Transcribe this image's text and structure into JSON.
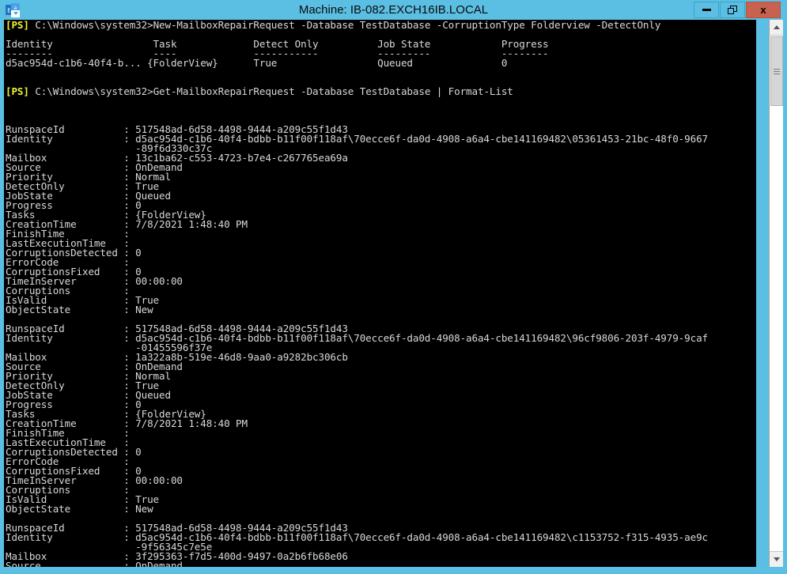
{
  "window": {
    "title": "Machine: IB-082.EXCH16IB.LOCAL",
    "icon": "exchange-icon",
    "minimize_label": "–",
    "restore_label": "❐",
    "close_label": "x",
    "colors": {
      "titlebar": "#5bbfe3",
      "close_button": "#c8614f",
      "console_background": "#000000",
      "console_text": "#d8d8d8",
      "prompt_text": "#f3f32e"
    }
  },
  "scrollbar": {
    "up_arrow": "scroll-up-arrow",
    "down_arrow": "scroll-down-arrow",
    "thumb": "scroll-thumb"
  },
  "console": {
    "prompt_prefix": "[PS]",
    "lines": [
      {
        "type": "command",
        "prompt": "[PS]",
        "text": " C:\\Windows\\system32>New-MailboxRepairRequest -Database TestDatabase -CorruptionType Folderview -DetectOnly"
      },
      {
        "type": "blank",
        "text": ""
      },
      {
        "type": "output",
        "text": "Identity                 Task             Detect Only          Job State            Progress"
      },
      {
        "type": "output",
        "text": "--------                 ----             -----------          ---------            --------"
      },
      {
        "type": "output",
        "text": "d5ac954d-c1b6-40f4-b... {FolderView}      True                 Queued               0"
      },
      {
        "type": "blank",
        "text": ""
      },
      {
        "type": "blank",
        "text": ""
      },
      {
        "type": "command",
        "prompt": "[PS]",
        "text": " C:\\Windows\\system32>Get-MailboxRepairRequest -Database TestDatabase | Format-List"
      },
      {
        "type": "blank",
        "text": ""
      },
      {
        "type": "blank",
        "text": ""
      },
      {
        "type": "blank",
        "text": ""
      },
      {
        "type": "output",
        "text": "RunspaceId          : 517548ad-6d58-4498-9444-a209c55f1d43"
      },
      {
        "type": "output",
        "text": "Identity            : d5ac954d-c1b6-40f4-bdbb-b11f00f118af\\70ecce6f-da0d-4908-a6a4-cbe141169482\\05361453-21bc-48f0-9667"
      },
      {
        "type": "output",
        "text": "                      -89f6d330c37c"
      },
      {
        "type": "output",
        "text": "Mailbox             : 13c1ba62-c553-4723-b7e4-c267765ea69a"
      },
      {
        "type": "output",
        "text": "Source              : OnDemand"
      },
      {
        "type": "output",
        "text": "Priority            : Normal"
      },
      {
        "type": "output",
        "text": "DetectOnly          : True"
      },
      {
        "type": "output",
        "text": "JobState            : Queued"
      },
      {
        "type": "output",
        "text": "Progress            : 0"
      },
      {
        "type": "output",
        "text": "Tasks               : {FolderView}"
      },
      {
        "type": "output",
        "text": "CreationTime        : 7/8/2021 1:48:40 PM"
      },
      {
        "type": "output",
        "text": "FinishTime          :"
      },
      {
        "type": "output",
        "text": "LastExecutionTime   :"
      },
      {
        "type": "output",
        "text": "CorruptionsDetected : 0"
      },
      {
        "type": "output",
        "text": "ErrorCode           :"
      },
      {
        "type": "output",
        "text": "CorruptionsFixed    : 0"
      },
      {
        "type": "output",
        "text": "TimeInServer        : 00:00:00"
      },
      {
        "type": "output",
        "text": "Corruptions         :"
      },
      {
        "type": "output",
        "text": "IsValid             : True"
      },
      {
        "type": "output",
        "text": "ObjectState         : New"
      },
      {
        "type": "blank",
        "text": ""
      },
      {
        "type": "output",
        "text": "RunspaceId          : 517548ad-6d58-4498-9444-a209c55f1d43"
      },
      {
        "type": "output",
        "text": "Identity            : d5ac954d-c1b6-40f4-bdbb-b11f00f118af\\70ecce6f-da0d-4908-a6a4-cbe141169482\\96cf9806-203f-4979-9caf"
      },
      {
        "type": "output",
        "text": "                      -01455596f37e"
      },
      {
        "type": "output",
        "text": "Mailbox             : 1a322a8b-519e-46d8-9aa0-a9282bc306cb"
      },
      {
        "type": "output",
        "text": "Source              : OnDemand"
      },
      {
        "type": "output",
        "text": "Priority            : Normal"
      },
      {
        "type": "output",
        "text": "DetectOnly          : True"
      },
      {
        "type": "output",
        "text": "JobState            : Queued"
      },
      {
        "type": "output",
        "text": "Progress            : 0"
      },
      {
        "type": "output",
        "text": "Tasks               : {FolderView}"
      },
      {
        "type": "output",
        "text": "CreationTime        : 7/8/2021 1:48:40 PM"
      },
      {
        "type": "output",
        "text": "FinishTime          :"
      },
      {
        "type": "output",
        "text": "LastExecutionTime   :"
      },
      {
        "type": "output",
        "text": "CorruptionsDetected : 0"
      },
      {
        "type": "output",
        "text": "ErrorCode           :"
      },
      {
        "type": "output",
        "text": "CorruptionsFixed    : 0"
      },
      {
        "type": "output",
        "text": "TimeInServer        : 00:00:00"
      },
      {
        "type": "output",
        "text": "Corruptions         :"
      },
      {
        "type": "output",
        "text": "IsValid             : True"
      },
      {
        "type": "output",
        "text": "ObjectState         : New"
      },
      {
        "type": "blank",
        "text": ""
      },
      {
        "type": "output",
        "text": "RunspaceId          : 517548ad-6d58-4498-9444-a209c55f1d43"
      },
      {
        "type": "output",
        "text": "Identity            : d5ac954d-c1b6-40f4-bdbb-b11f00f118af\\70ecce6f-da0d-4908-a6a4-cbe141169482\\c1153752-f315-4935-ae9c"
      },
      {
        "type": "output",
        "text": "                      -9f56345c7e5e"
      },
      {
        "type": "output",
        "text": "Mailbox             : 3f295363-f7d5-400d-9497-0a2b6fb68e06"
      },
      {
        "type": "output",
        "text": "Source              : OnDemand"
      }
    ]
  }
}
